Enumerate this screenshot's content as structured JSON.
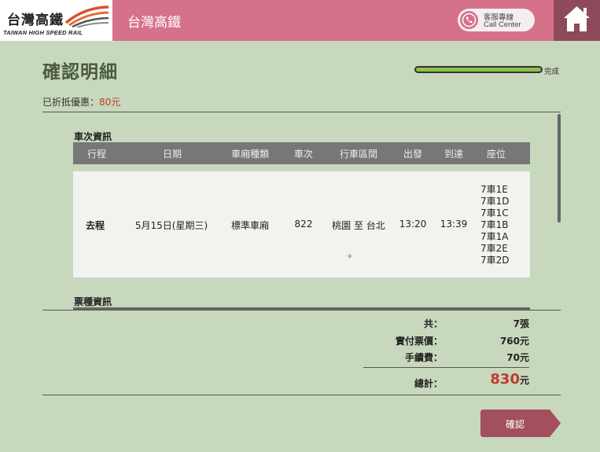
{
  "header": {
    "logo_cn": "台灣高鐵",
    "logo_en": "TAIWAN HIGH SPEED RAIL",
    "title": "台灣高鐵",
    "call_center_cn": "客服專線",
    "call_center_en": "Call Center",
    "home_icon": "home-icon",
    "phone_icon": "phone-icon"
  },
  "page": {
    "title": "確認明細",
    "progress_label": "完成",
    "progress_fraction": 1.0,
    "discount_label": "已折抵優惠：",
    "discount_amount": "80元"
  },
  "train_info": {
    "section_title": "車次資訊",
    "columns": [
      "行程",
      "日期",
      "車廂種類",
      "車次",
      "行車區間",
      "出發",
      "到達",
      "座位"
    ],
    "row": {
      "trip": "去程",
      "date": "5月15日(星期三)",
      "car_type": "標準車廂",
      "train_no": "822",
      "route": "桃園 至 台北",
      "depart": "13:20",
      "arrive": "13:39",
      "seats": [
        "7車1E",
        "7車1D",
        "7車1C",
        "7車1B",
        "7車1A",
        "7車2E",
        "7車2D"
      ]
    }
  },
  "ticket_info": {
    "section_title": "票種資訊"
  },
  "summary": {
    "count_label": "共：",
    "count_value": "7張",
    "fare_label": "實付票價：",
    "fare_value": "760元",
    "fee_label": "手續費：",
    "fee_value": "70元",
    "total_label": "總計：",
    "total_value": "830",
    "total_unit": "元"
  },
  "actions": {
    "confirm_label": "確認"
  },
  "colors": {
    "background": "#c7d8bd",
    "header_pink": "#d6718a",
    "home_maroon": "#8c4a5b",
    "button_maroon": "#a24f5e",
    "progress_green": "#8bc34a",
    "accent_red": "#c0392b"
  }
}
